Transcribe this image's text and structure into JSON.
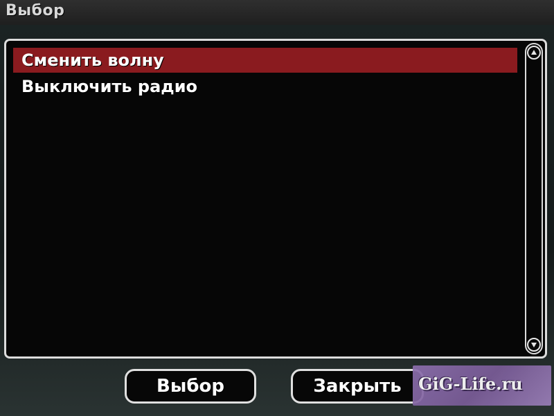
{
  "dialog": {
    "title": "Выбор"
  },
  "list": {
    "items": [
      {
        "label": "Сменить волну",
        "selected": true
      },
      {
        "label": "Выключить радио",
        "selected": false
      }
    ]
  },
  "scrollbar": {
    "up_icon": "chevron-up-icon",
    "down_icon": "chevron-down-icon"
  },
  "buttons": {
    "select_label": "Выбор",
    "close_label": "Закрыть"
  },
  "watermark": {
    "text": "GiG-Life.ru"
  },
  "colors": {
    "selection": "#8a1b1f",
    "border": "#dcdcdc",
    "panel_background": "#060606",
    "watermark_background": "#8d6fae"
  }
}
